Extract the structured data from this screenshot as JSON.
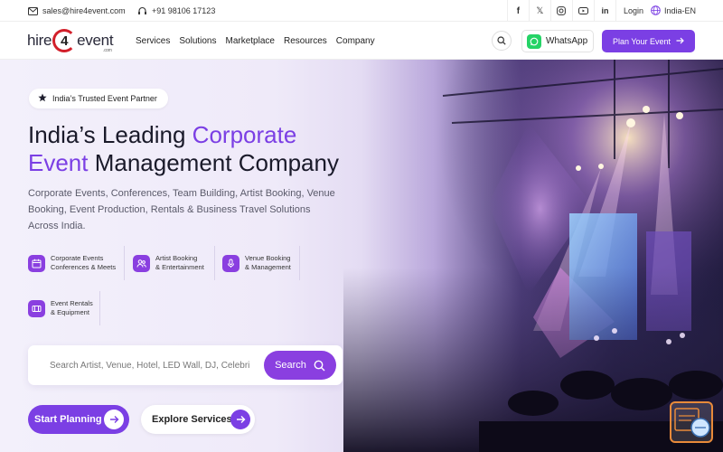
{
  "topbar": {
    "email": "sales@hire4event.com",
    "phone": "+91 98106 17123",
    "login": "Login",
    "lang": "India-EN"
  },
  "header": {
    "logo_left": "hire",
    "logo_four": "4",
    "logo_right": "event",
    "logo_com": ".com",
    "nav": [
      "Services",
      "Solutions",
      "Marketplace",
      "Resources",
      "Company"
    ],
    "whatsapp_label": "WhatsApp",
    "plan_label": "Plan Your Event"
  },
  "hero": {
    "badge": "India’s Trusted Event Partner",
    "title_part1": "India’s Leading ",
    "title_accent1": "Corporate",
    "title_accent2": "Event",
    "title_part2": " Management Company",
    "subtitle": "Corporate Events, Conferences, Team Building, Artist Booking, Venue Booking, Event Production, Rentals & Business Travel Solutions Across India.",
    "categories": [
      {
        "line1": "Corporate Events",
        "line2": "Conferences & Meets",
        "icon": "calendar-icon"
      },
      {
        "line1": "Artist Booking",
        "line2": "& Entertainment",
        "icon": "people-icon"
      },
      {
        "line1": "Venue Booking",
        "line2": "& Management",
        "icon": "mic-icon"
      },
      {
        "line1": "Event Rentals",
        "line2": "& Equipment",
        "icon": "truck-icon"
      }
    ],
    "search_placeholder": "Search Artist, Venue, Hotel, LED Wall, DJ, Celebri",
    "search_label": "Search",
    "start_label": "Start Planning",
    "explore_label": "Explore Services"
  },
  "colors": {
    "accent": "#7b3fe4",
    "whatsapp": "#25d366",
    "logo_red": "#d21f2a"
  }
}
